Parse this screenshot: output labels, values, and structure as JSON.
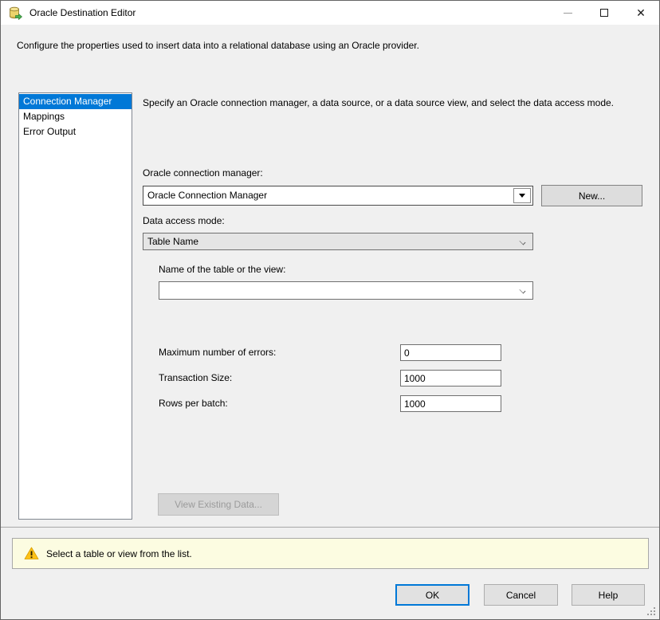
{
  "window": {
    "title": "Oracle Destination Editor",
    "description": "Configure the properties used to insert data into a relational database using an Oracle provider.",
    "controls": {
      "minimize": "minimize",
      "maximize": "maximize",
      "close": "close"
    }
  },
  "icons": {
    "app": "database-destination-icon",
    "warning": "warning-triangle-icon",
    "combo_arrow": "dropdown-arrow-icon",
    "chevron": "chevron-down-icon"
  },
  "colors": {
    "accent": "#0078D7",
    "selection_bg": "#0078D7",
    "warning_bg": "#FCFCE1",
    "titlebar_bg": "#FFFFFF",
    "dialog_bg": "#F0F0F0"
  },
  "sidebar": {
    "items": [
      {
        "label": "Connection Manager",
        "selected": true
      },
      {
        "label": "Mappings",
        "selected": false
      },
      {
        "label": "Error Output",
        "selected": false
      }
    ]
  },
  "main": {
    "heading": "Specify an Oracle connection manager, a data source, or a data source view, and select the data access mode.",
    "connection_manager": {
      "label": "Oracle connection manager:",
      "value": "Oracle Connection Manager"
    },
    "new_button": "New...",
    "data_access_mode": {
      "label": "Data access mode:",
      "value": "Table Name"
    },
    "table_name": {
      "label": "Name of the table or the view:",
      "value": ""
    },
    "max_errors": {
      "label": "Maximum number of errors:",
      "value": "0"
    },
    "transaction_size": {
      "label": "Transaction Size:",
      "value": "1000"
    },
    "rows_per_batch": {
      "label": "Rows per batch:",
      "value": "1000"
    },
    "view_existing_data_button": "View Existing Data..."
  },
  "warning": {
    "text": "Select a table or view from the list."
  },
  "footer": {
    "ok": "OK",
    "cancel": "Cancel",
    "help": "Help"
  }
}
